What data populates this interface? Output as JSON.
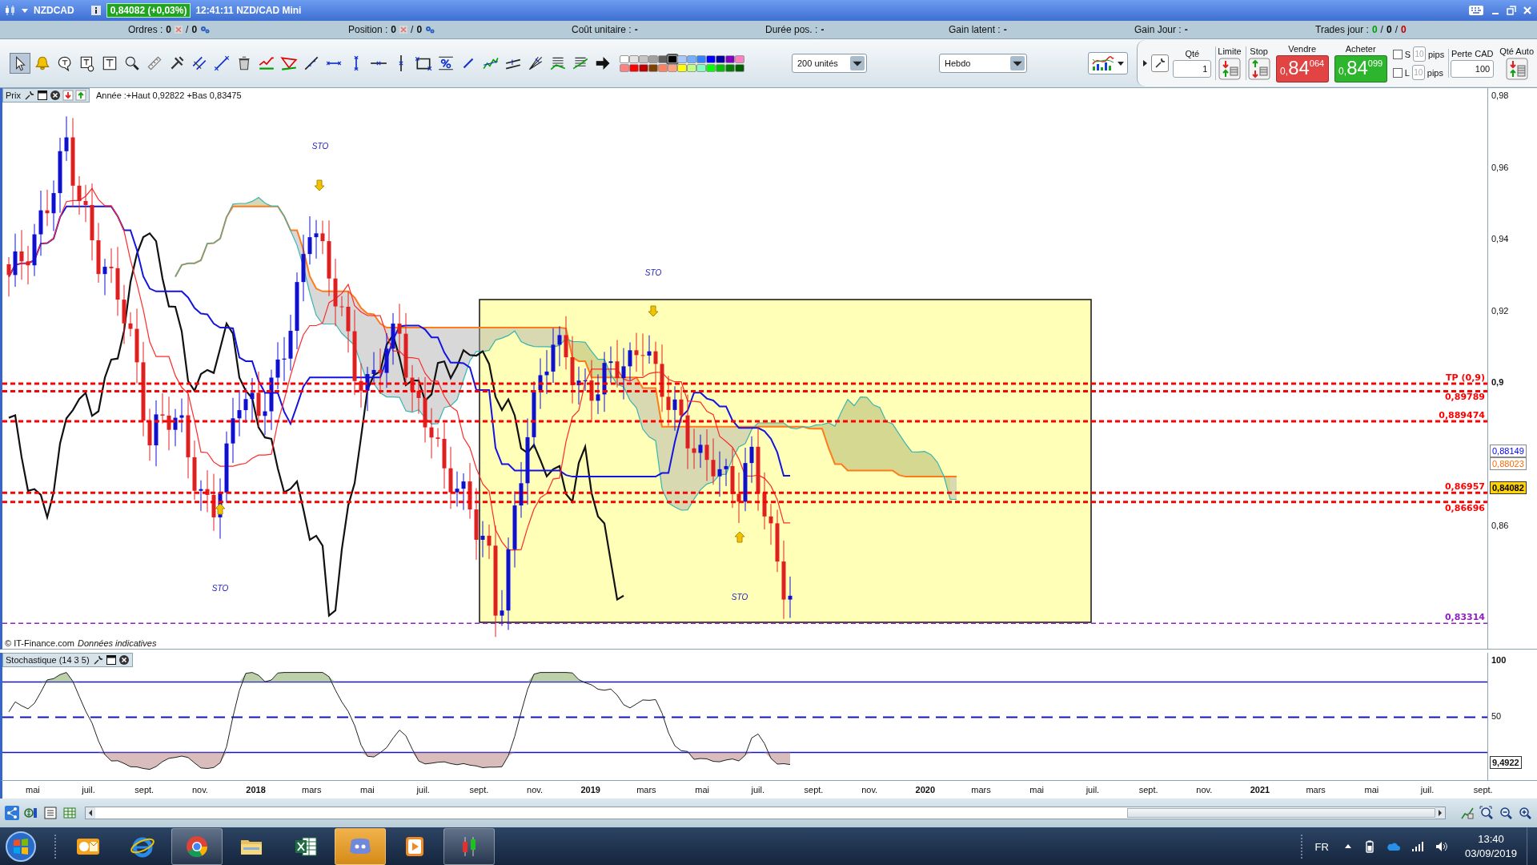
{
  "window": {
    "symbol": "NZDCAD",
    "quote": "0,84082 (+0,03%)",
    "subtitle": "12:41:11 NZD/CAD Mini"
  },
  "info_bar": [
    {
      "kind": "pair",
      "label": "Ordres :",
      "values": [
        "0",
        "0"
      ],
      "separator": "/"
    },
    {
      "kind": "pair",
      "label": "Position :",
      "values": [
        "0",
        "0"
      ],
      "separator": "/"
    },
    {
      "kind": "single",
      "label": "Coût unitaire :",
      "value": "-"
    },
    {
      "kind": "single",
      "label": "Durée pos. :",
      "value": "-"
    },
    {
      "kind": "single",
      "label": "Gain latent :",
      "value": "-"
    },
    {
      "kind": "single",
      "label": "Gain Jour :",
      "value": "-"
    },
    {
      "kind": "triple",
      "label": "Trades jour :",
      "separator": "/",
      "values": [
        {
          "text": "0",
          "color": "#00a000"
        },
        {
          "text": "0",
          "color": "#000000"
        },
        {
          "text": "0",
          "color": "#c00000"
        }
      ]
    }
  ],
  "tools": [
    {
      "selected": true
    },
    {
      "selected": false
    },
    {
      "selected": false
    },
    {
      "selected": false
    },
    {
      "selected": false
    },
    {
      "selected": false
    },
    {
      "selected": false
    },
    {
      "selected": false
    },
    {
      "selected": false
    },
    {
      "selected": false
    },
    {
      "selected": false
    },
    {
      "selected": false
    },
    {
      "selected": false
    },
    {
      "selected": false
    },
    {
      "selected": false
    },
    {
      "selected": false
    },
    {
      "selected": false
    },
    {
      "selected": false
    },
    {
      "selected": false
    },
    {
      "selected": false
    },
    {
      "selected": false
    },
    {
      "selected": false
    },
    {
      "selected": false
    },
    {
      "selected": false
    },
    {
      "selected": false
    },
    {
      "selected": false
    },
    {
      "selected": false
    }
  ],
  "palette": [
    {
      "color": "#ffffff",
      "selected": false
    },
    {
      "color": "#e4e4e4",
      "selected": false
    },
    {
      "color": "#c4c4c4",
      "selected": false
    },
    {
      "color": "#a0a0a0",
      "selected": false
    },
    {
      "color": "#606060",
      "selected": false
    },
    {
      "color": "#000000",
      "selected": true
    },
    {
      "color": "#a8c8f8",
      "selected": false
    },
    {
      "color": "#70b0ff",
      "selected": false
    },
    {
      "color": "#3080ff",
      "selected": false
    },
    {
      "color": "#0000ff",
      "selected": false
    },
    {
      "color": "#0000a0",
      "selected": false
    },
    {
      "color": "#8000c0",
      "selected": false
    },
    {
      "color": "#ff80c0",
      "selected": false
    },
    {
      "color": "#ff8080",
      "selected": false
    },
    {
      "color": "#ff0000",
      "selected": false
    },
    {
      "color": "#c00000",
      "selected": false
    },
    {
      "color": "#804000",
      "selected": false
    },
    {
      "color": "#ff8060",
      "selected": false
    },
    {
      "color": "#ffa080",
      "selected": false
    },
    {
      "color": "#ffff00",
      "selected": false
    },
    {
      "color": "#c0ff80",
      "selected": false
    },
    {
      "color": "#80ffc0",
      "selected": false
    },
    {
      "color": "#00ff00",
      "selected": false
    },
    {
      "color": "#00c000",
      "selected": false
    },
    {
      "color": "#008000",
      "selected": false
    },
    {
      "color": "#006000",
      "selected": false
    }
  ],
  "selects": [
    {
      "value": "200 unités"
    },
    {
      "value": "Hebdo"
    }
  ],
  "order_panel": {
    "qty_label": "Qté",
    "qty": "1",
    "limit_label": "Limite",
    "stop_label": "Stop",
    "sell": {
      "label": "Vendre",
      "prefix": "0,",
      "big": "84",
      "small": "064"
    },
    "buy": {
      "label": "Acheter",
      "prefix": "0,",
      "big": "84",
      "small": "099"
    },
    "toggles": [
      {
        "label": "S",
        "checked": false,
        "pips": "10",
        "unit": "pips"
      },
      {
        "label": "L",
        "checked": false,
        "pips": "10",
        "unit": "pips"
      }
    ],
    "loss_label": "Perte CAD",
    "loss": "100",
    "auto_label": "Qté Auto"
  },
  "price_pane": {
    "title": "Prix",
    "summary": "Année :+Haut 0,92822 +Bas 0,83475",
    "axis_ticks": [
      {
        "label": "0,98",
        "bold": false
      },
      {
        "label": "0,96",
        "bold": false
      },
      {
        "label": "0,94",
        "bold": false
      },
      {
        "label": "0,92",
        "bold": false
      },
      {
        "label": "0,9",
        "bold": true
      },
      {
        "label": "0,86",
        "bold": false
      }
    ],
    "value_tags": [
      {
        "kind": "line",
        "label": "0,88149",
        "color": "#0000ff"
      },
      {
        "kind": "line",
        "label": "0,88023",
        "color": "#ff6a00"
      },
      {
        "kind": "current",
        "label": "0,84082"
      }
    ],
    "levels": [
      {
        "label": "TP (0,9)",
        "color": "#ff0000"
      },
      {
        "label": "0,89789",
        "color": "#ff0000"
      },
      {
        "label": "0,889474",
        "color": "#ff0000"
      },
      {
        "label": "0,86957",
        "color": "#ff0000"
      },
      {
        "label": "0,86696",
        "color": "#ff0000"
      },
      {
        "label": "0,83314",
        "color": "#9020c0"
      }
    ],
    "signals": [
      {
        "label": "STO",
        "kind": "down"
      },
      {
        "label": "STO",
        "kind": "down"
      },
      {
        "label": "STO",
        "kind": "up"
      },
      {
        "label": "STO",
        "kind": "up"
      }
    ],
    "copyright": "© IT-Finance.com",
    "disclaimer": "Données indicatives"
  },
  "stoch_pane": {
    "title": "Stochastique (14 3 5)",
    "axis_ticks": [
      {
        "label": "100",
        "bold": true
      },
      {
        "label": "50",
        "bold": false
      }
    ],
    "value_tag": "9,4922"
  },
  "time_axis": [
    {
      "label": "mai",
      "kind": "month"
    },
    {
      "label": "juil.",
      "kind": "month"
    },
    {
      "label": "sept.",
      "kind": "month"
    },
    {
      "label": "nov.",
      "kind": "month"
    },
    {
      "label": "2018",
      "kind": "year"
    },
    {
      "label": "mars",
      "kind": "month"
    },
    {
      "label": "mai",
      "kind": "month"
    },
    {
      "label": "juil.",
      "kind": "month"
    },
    {
      "label": "sept.",
      "kind": "month"
    },
    {
      "label": "nov.",
      "kind": "month"
    },
    {
      "label": "2019",
      "kind": "year"
    },
    {
      "label": "mars",
      "kind": "month"
    },
    {
      "label": "mai",
      "kind": "month"
    },
    {
      "label": "juil.",
      "kind": "month"
    },
    {
      "label": "sept.",
      "kind": "month"
    },
    {
      "label": "nov.",
      "kind": "month"
    },
    {
      "label": "2020",
      "kind": "year"
    },
    {
      "label": "mars",
      "kind": "month"
    },
    {
      "label": "mai",
      "kind": "month"
    },
    {
      "label": "juil.",
      "kind": "month"
    },
    {
      "label": "sept.",
      "kind": "month"
    },
    {
      "label": "nov.",
      "kind": "month"
    },
    {
      "label": "2021",
      "kind": "year"
    },
    {
      "label": "mars",
      "kind": "month"
    },
    {
      "label": "mai",
      "kind": "month"
    },
    {
      "label": "juil.",
      "kind": "month"
    },
    {
      "label": "sept.",
      "kind": "month"
    }
  ],
  "taskbar": {
    "apps": [
      {
        "kind": "mail",
        "running": false,
        "attention": false
      },
      {
        "kind": "ie",
        "running": false,
        "attention": false
      },
      {
        "kind": "chrome",
        "running": true,
        "attention": false
      },
      {
        "kind": "folder",
        "running": false,
        "attention": false
      },
      {
        "kind": "excel",
        "running": false,
        "attention": false
      },
      {
        "kind": "chat",
        "running": true,
        "attention": true
      },
      {
        "kind": "player",
        "running": false,
        "attention": false
      },
      {
        "kind": "trading",
        "running": true,
        "attention": false
      }
    ],
    "language": "FR",
    "time": "13:40",
    "date": "03/09/2019"
  }
}
